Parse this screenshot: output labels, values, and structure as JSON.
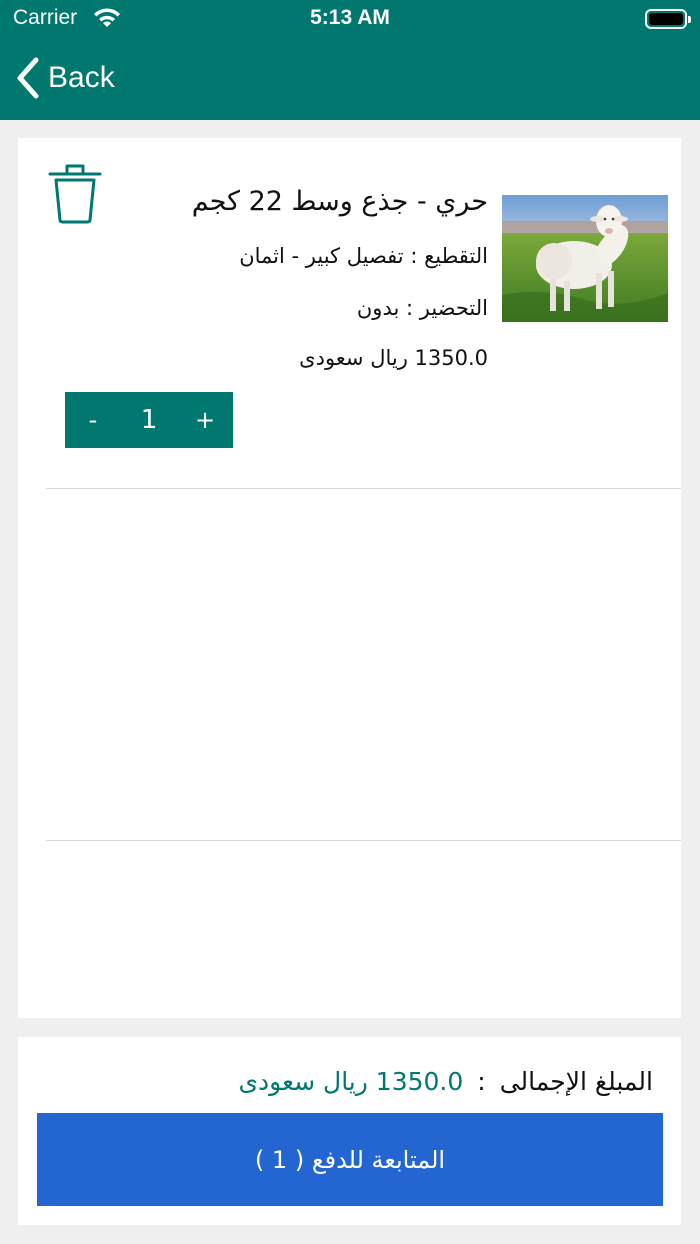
{
  "status_bar": {
    "carrier": "Carrier",
    "time": "5:13 AM"
  },
  "nav": {
    "back_label": "Back"
  },
  "cart_item": {
    "title": "حري - جذع وسط 22 كجم",
    "cutting": "التقطيع : تفصيل كبير - اثمان",
    "preparation": "التحضير : بدون",
    "price": "1350.0 ريال سعودى",
    "quantity": "1",
    "minus_label": "-",
    "plus_label": "+",
    "image_icon": "sheep-photo-icon",
    "delete_icon": "trash-icon"
  },
  "summary": {
    "total_label": "المبلغ الإجمالى",
    "separator": ":",
    "total_value": "1350.0 ريال سعودى",
    "checkout_label": "المتابعة للدفع ( 1 )"
  },
  "colors": {
    "primary": "#00786f",
    "button": "#2366d1",
    "background": "#efefef"
  }
}
